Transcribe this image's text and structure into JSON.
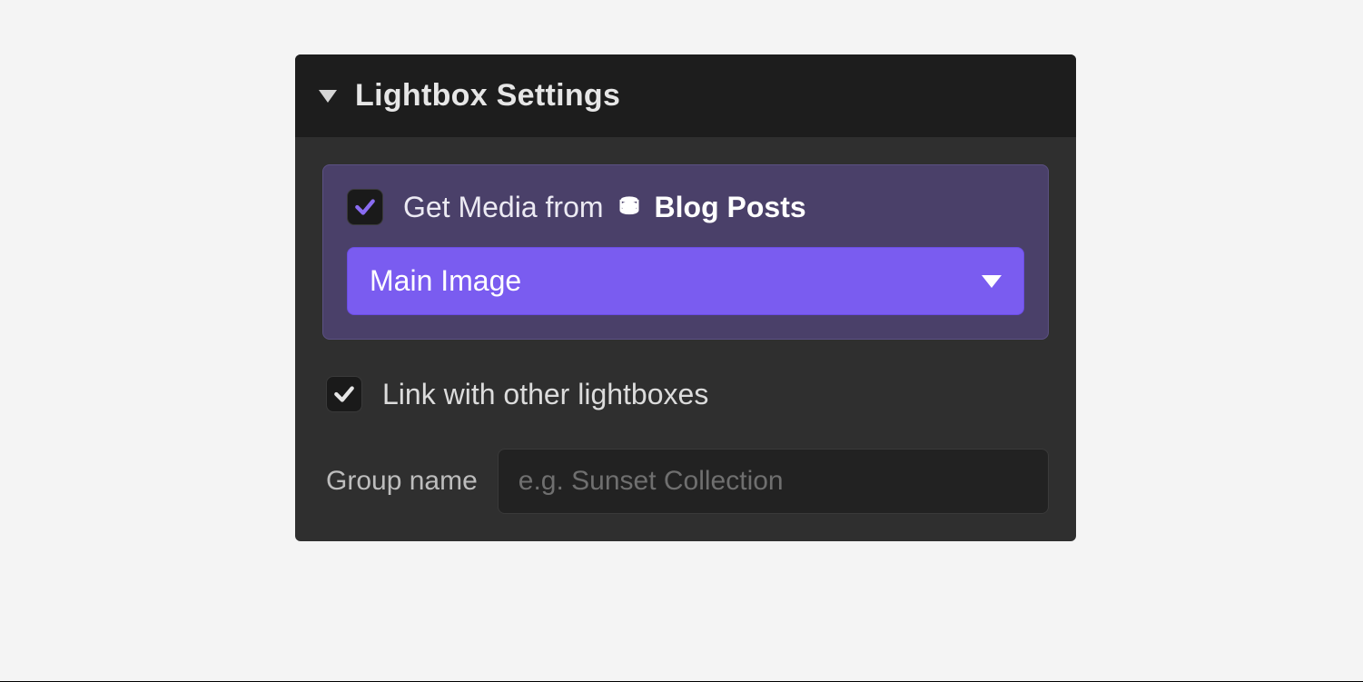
{
  "panel": {
    "title": "Lightbox Settings"
  },
  "media": {
    "checkbox_checked": true,
    "lead_text": "Get Media from",
    "source_name": "Blog Posts",
    "dropdown_selected": "Main Image"
  },
  "link_other": {
    "checkbox_checked": true,
    "label": "Link with other lightboxes"
  },
  "group": {
    "label": "Group name",
    "value": "",
    "placeholder": "e.g. Sunset Collection"
  },
  "colors": {
    "accent": "#7a5cf0",
    "accent_dark": "#4a4069",
    "panel_bg": "#2f2f2f",
    "header_bg": "#1d1d1d"
  }
}
